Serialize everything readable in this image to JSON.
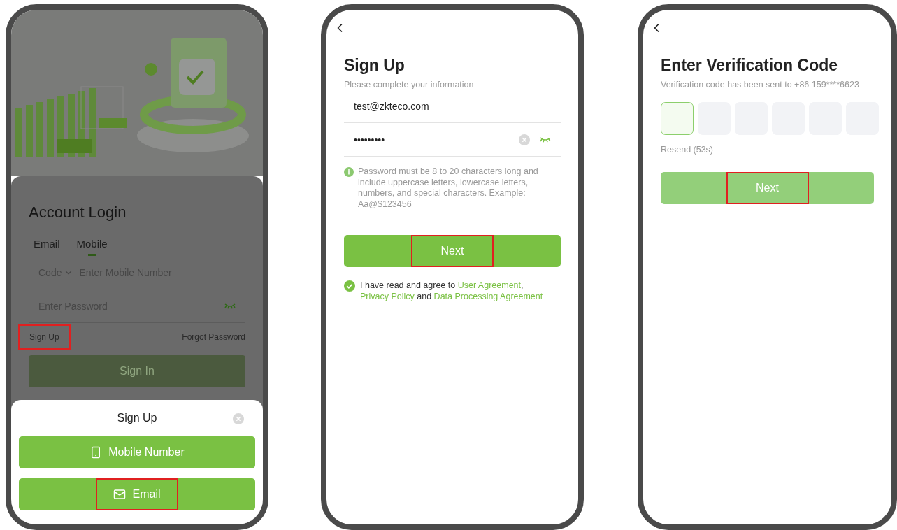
{
  "login_screen": {
    "dimmed": true,
    "title": "Account Login",
    "tabs": [
      {
        "label": "Email",
        "selected": false
      },
      {
        "label": "Mobile",
        "selected": true
      }
    ],
    "code_selector": "Code",
    "mobile_field": {
      "placeholder": "Enter Mobile Number"
    },
    "password_field": {
      "placeholder": "Enter Password"
    },
    "sign_up_link": {
      "label": "Sign Up",
      "highlighted": true
    },
    "forgot_password_link": "Forgot Password",
    "sign_in_button": "Sign In"
  },
  "sign_up_sheet": {
    "title": "Sign Up",
    "options": [
      {
        "kind": "mobile",
        "label": "Mobile Number",
        "highlighted": false
      },
      {
        "kind": "email",
        "label": "Email",
        "highlighted": true
      }
    ]
  },
  "signup_screen": {
    "title": "Sign Up",
    "subtitle": "Please complete your information",
    "email_field": {
      "value": "test@zkteco.com"
    },
    "password_field": {
      "value": "•••••••••"
    },
    "hint": "Password must be 8 to 20 characters long and include uppercase letters, lowercase letters, numbers, and special characters. Example: Aa@$123456",
    "next_button": {
      "label": "Next",
      "highlighted": true,
      "disabled": false
    },
    "agreement": {
      "checked": true,
      "parts": [
        {
          "kind": "text",
          "text": "I have read and agree to "
        },
        {
          "kind": "link",
          "text": "User Agreement"
        },
        {
          "kind": "text",
          "text": ", "
        },
        {
          "kind": "link",
          "text": "Privacy Policy"
        },
        {
          "kind": "text",
          "text": " and "
        },
        {
          "kind": "link",
          "text": "Data Processing Agreement"
        }
      ]
    }
  },
  "verification_screen": {
    "title": "Enter Verification Code",
    "subtitle": "Verification code has been sent to +86 159****6623",
    "code_boxes": [
      {
        "selected": true
      },
      {
        "selected": false
      },
      {
        "selected": false
      },
      {
        "selected": false
      },
      {
        "selected": false
      },
      {
        "selected": false
      }
    ],
    "resend": "Resend (53s)",
    "next_button": {
      "label": "Next",
      "highlighted": true,
      "disabled": true
    }
  }
}
